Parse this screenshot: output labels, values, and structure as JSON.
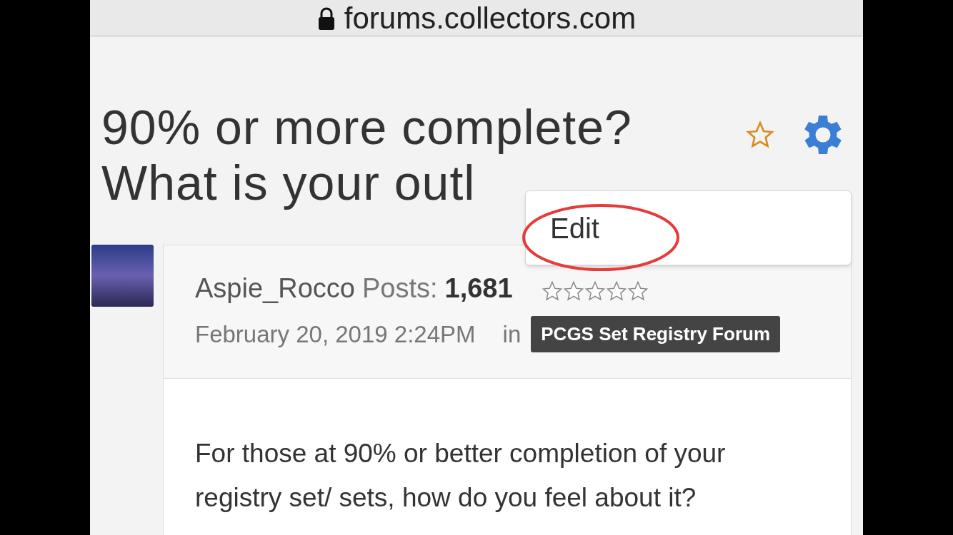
{
  "address_bar": {
    "url": "forums.collectors.com"
  },
  "thread": {
    "title_lines": [
      "90% or more complete?",
      "What is your outl"
    ],
    "bookmarked": false
  },
  "menu": {
    "items": [
      {
        "label": "Edit"
      }
    ]
  },
  "post": {
    "author": "Aspie_Rocco",
    "posts_label": "Posts:",
    "posts_count": "1,681",
    "stars": 0,
    "date": "February 20, 2019 2:24PM",
    "in_label": "in",
    "category": "PCGS Set Registry Forum",
    "body": "For those at 90% or better completion of your registry set/ sets, how do you feel about it?"
  }
}
